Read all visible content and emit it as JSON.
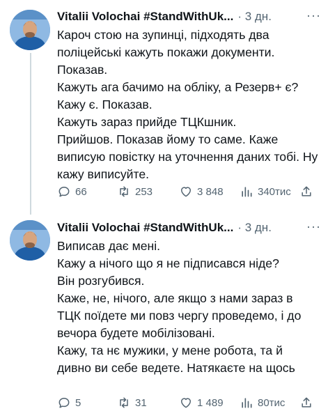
{
  "tweets": [
    {
      "name": "Vitalii Volochai #StandWithUk...",
      "meta": "· 3 дн.",
      "more": "···",
      "lines": [
        "Кароч стою на зупинці, підходять два поліцейські кажуть покажи документи.",
        "Показав.",
        "Кажуть ага бачимо на обліку, а Резерв+ є? Кажу є. Показав.",
        "Кажуть зараз прийде ТЦКшник.",
        "Прийшов. Показав йому то саме. Каже виписую повістку на уточнення даних тобі. Ну кажу виписуйте."
      ],
      "replies": "66",
      "retweets": "253",
      "likes": "3 848",
      "views": "340тис"
    },
    {
      "name": "Vitalii Volochai #StandWithUk...",
      "meta": "· 3 дн.",
      "more": "···",
      "lines": [
        "Виписав дає мені.",
        "Кажу а нічого що я не підписався ніде?",
        "Він розгубився.",
        "Каже, не, нічого, але якщо з нами зараз в ТЦК поїдете ми повз чергу проведемо, і до вечора будете мобілізовані.",
        "Кажу, та нє мужики, у мене робота, та й дивно ви себе ведете. Натякаєте на щось"
      ],
      "replies": "5",
      "retweets": "31",
      "likes": "1 489",
      "views": "80тис"
    }
  ],
  "icons": {
    "reply": "reply-icon",
    "retweet": "retweet-icon",
    "like": "heart-icon",
    "views": "views-icon",
    "share": "share-icon"
  },
  "colors": {
    "text": "#0f1419",
    "secondary": "#536471",
    "thread_line": "#cfd9de",
    "avatar_bg": "#6aa3d6"
  }
}
